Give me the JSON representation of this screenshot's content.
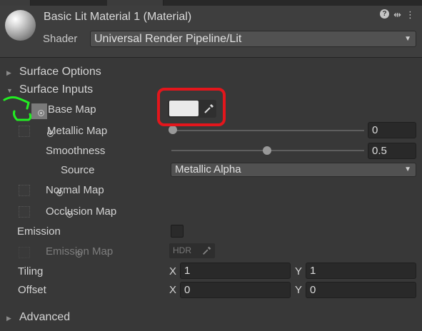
{
  "material": {
    "title": "Basic Lit Material 1 (Material)",
    "shader_label": "Shader",
    "shader_value": "Universal Render Pipeline/Lit",
    "header_icons": [
      "help-icon",
      "sliders-icon",
      "more-icon"
    ]
  },
  "sections": {
    "surface_options": "Surface Options",
    "surface_inputs": "Surface Inputs",
    "advanced": "Advanced"
  },
  "properties": {
    "base_map": {
      "label": "Base Map",
      "color": "#eaeaea"
    },
    "metallic_map": {
      "label": "Metallic Map",
      "value": "0",
      "slider_fraction": 0.0
    },
    "smoothness": {
      "label": "Smoothness",
      "value": "0.5",
      "slider_fraction": 0.5
    },
    "source": {
      "label": "Source",
      "value": "Metallic Alpha"
    },
    "normal_map": {
      "label": "Normal Map"
    },
    "occlusion_map": {
      "label": "Occlusion Map"
    },
    "emission": {
      "label": "Emission",
      "checked": false
    },
    "emission_map": {
      "label": "Emission Map",
      "hdr_label": "HDR"
    },
    "tiling": {
      "label": "Tiling",
      "x_label": "X",
      "x": "1",
      "y_label": "Y",
      "y": "1"
    },
    "offset": {
      "label": "Offset",
      "x_label": "X",
      "x": "0",
      "y_label": "Y",
      "y": "0"
    }
  },
  "annotations": {
    "red_box_color": "#e3161c",
    "green_mark_color": "#22ee22"
  }
}
